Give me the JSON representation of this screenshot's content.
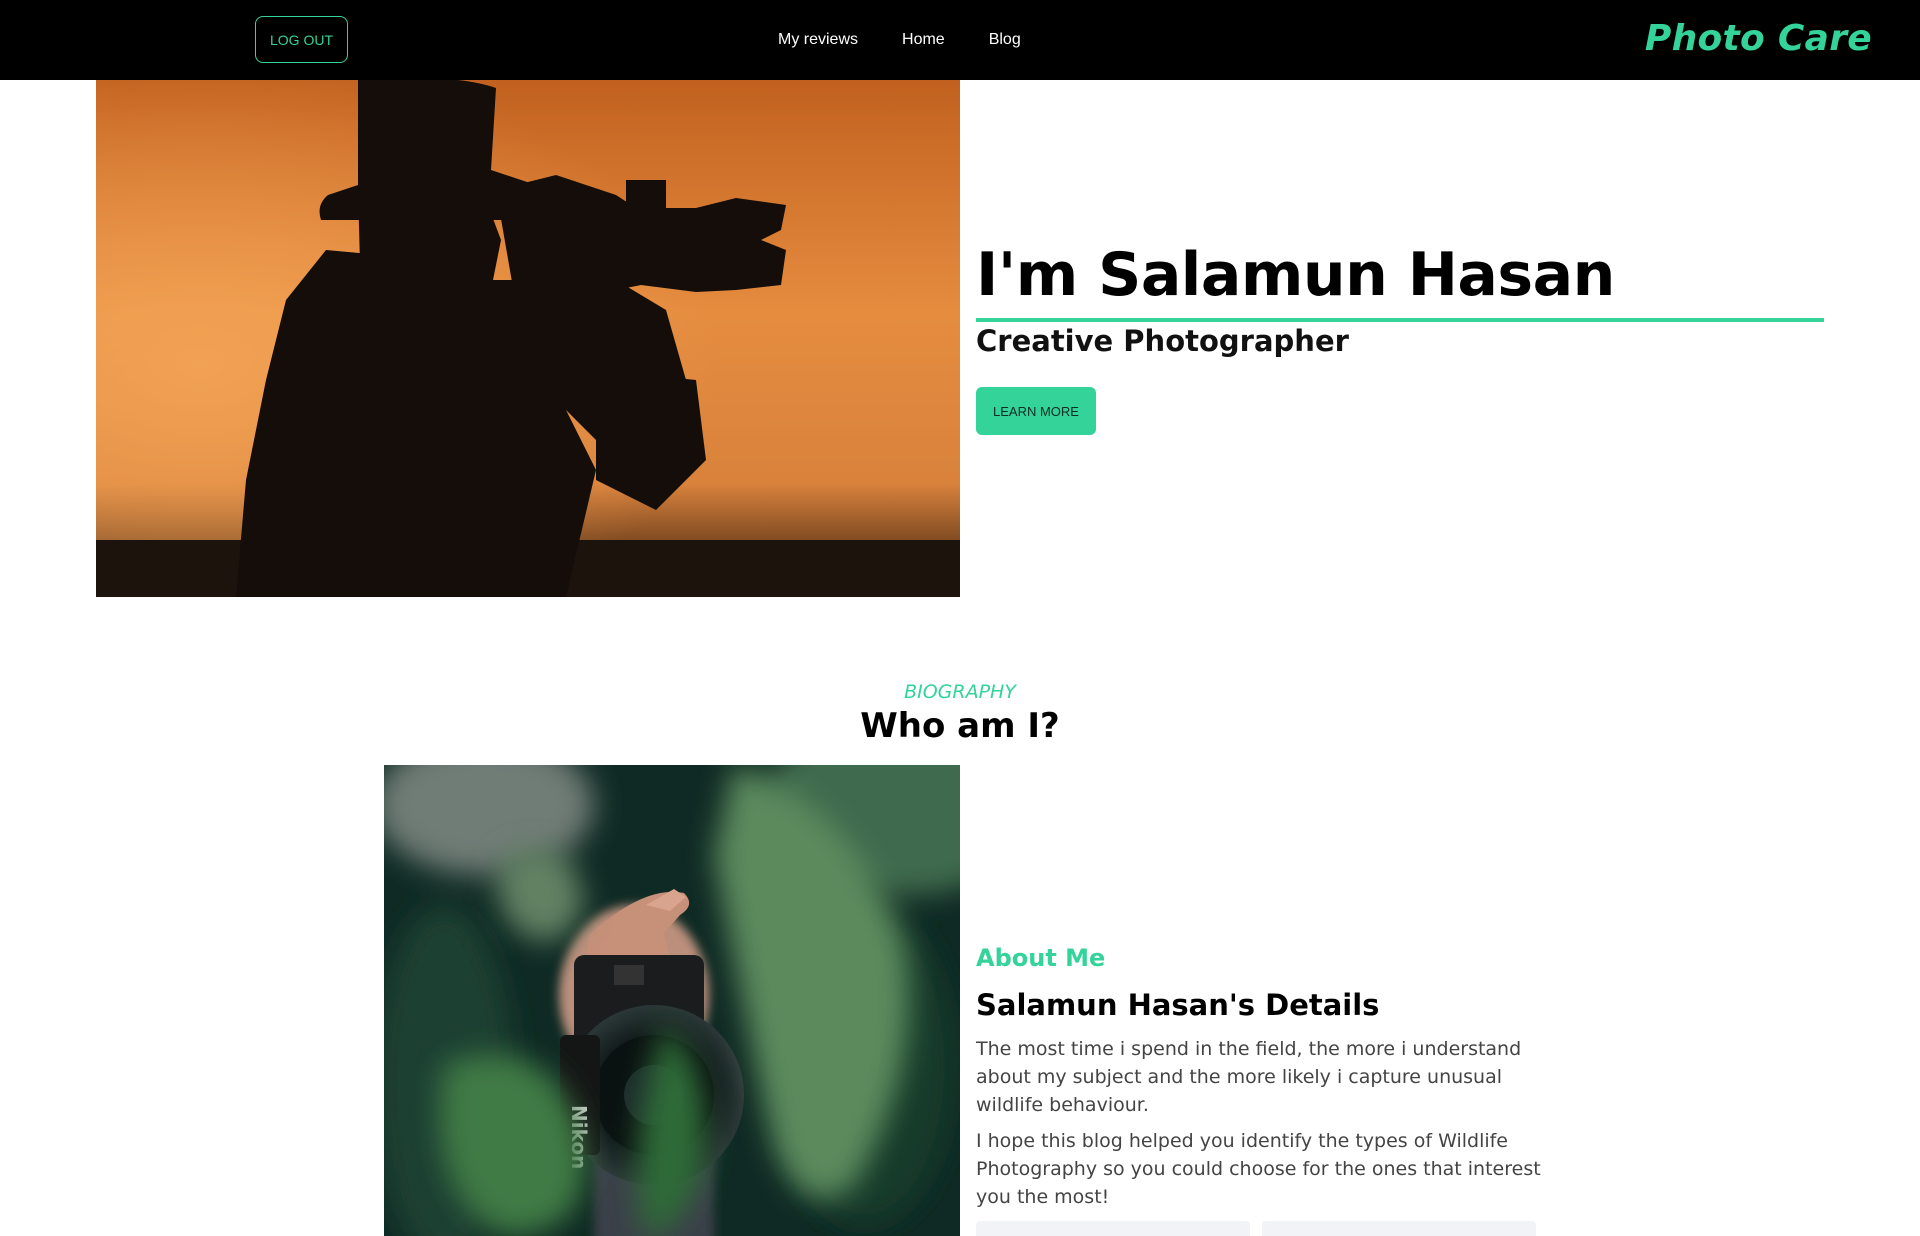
{
  "navbar": {
    "logout_label": "LOG OUT",
    "links": [
      {
        "label": "My reviews"
      },
      {
        "label": "Home"
      },
      {
        "label": "Blog"
      }
    ],
    "brand": "Photo Care"
  },
  "hero": {
    "name": "I'm Salamun Hasan",
    "role": "Creative Photographer",
    "cta_label": "LEARN MORE"
  },
  "biography": {
    "eyebrow": "BIOGRAPHY",
    "title": "Who am I?",
    "about_label": "About Me",
    "details_title": "Salamun Hasan's Details",
    "paragraphs": [
      "The most time i spend in the field, the more i understand about my subject and the more likely i capture unusual wildlife behaviour.",
      "I hope this blog helped you identify the types of Wildlife Photography so you could choose for the ones that interest you the most!"
    ]
  },
  "colors": {
    "accent": "#34d399",
    "navbar_bg": "#000000"
  }
}
